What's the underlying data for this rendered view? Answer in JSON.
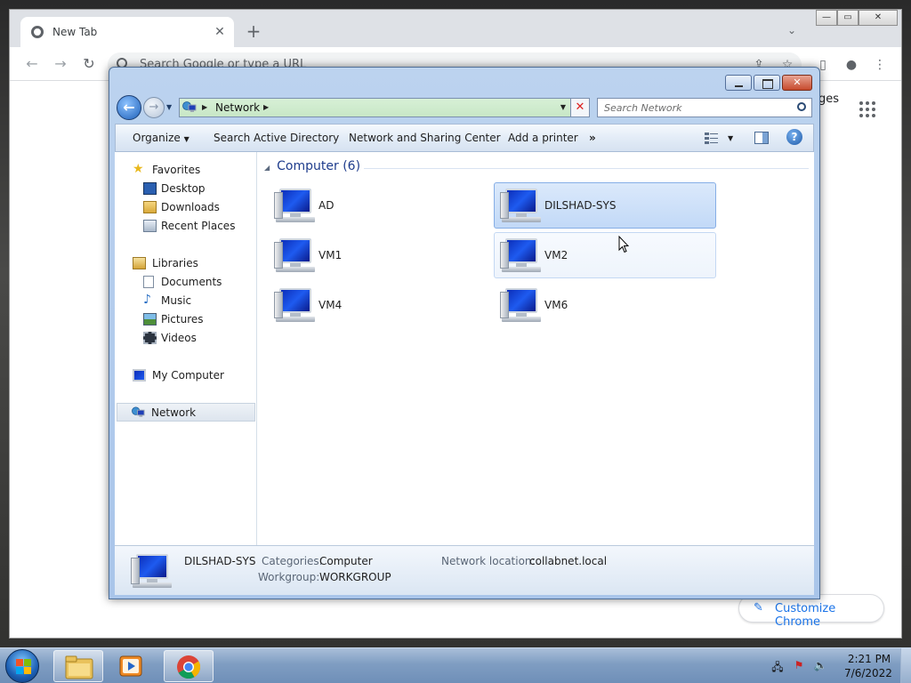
{
  "chrome": {
    "tab_title": "New Tab",
    "tab_close": "✕",
    "new_tab": "+",
    "tab_search": "⌄",
    "omnibox_placeholder": "Search Google or type a URL",
    "links_text": "ges",
    "customize_label": "Customize Chrome"
  },
  "explorer": {
    "address_crumb": "Network",
    "search_placeholder": "Search Network",
    "commands": {
      "organize": "Organize",
      "search_ad": "Search Active Directory",
      "network_sharing": "Network and Sharing Center",
      "add_printer": "Add a printer",
      "more": "»"
    },
    "nav": {
      "favorites": "Favorites",
      "desktop": "Desktop",
      "downloads": "Downloads",
      "recent": "Recent Places",
      "libraries": "Libraries",
      "documents": "Documents",
      "music": "Music",
      "pictures": "Pictures",
      "videos": "Videos",
      "my_computer": "My Computer",
      "network": "Network"
    },
    "group_header": "Computer (6)",
    "computers": [
      "AD",
      "DILSHAD-SYS",
      "VM1",
      "VM2",
      "VM4",
      "VM6"
    ],
    "details": {
      "name": "DILSHAD-SYS",
      "categories_label": "Categories:",
      "categories_value": "Computer",
      "workgroup_label": "Workgroup:",
      "workgroup_value": "WORKGROUP",
      "location_label": "Network location:",
      "location_value": "collabnet.local"
    }
  },
  "taskbar": {
    "time": "2:21 PM",
    "date": "7/6/2022"
  },
  "colors": {
    "explorer_frame": "#bcd3ef",
    "selection": "#c2d9f7",
    "taskbar": "#7f9dc2",
    "chrome_accent": "#1a73e8"
  }
}
